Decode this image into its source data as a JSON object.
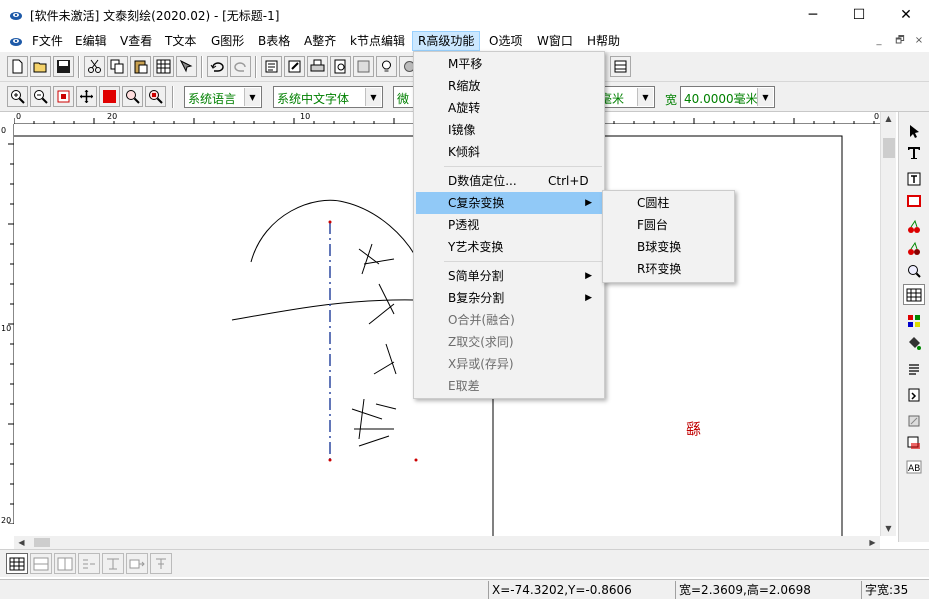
{
  "window": {
    "title": "[软件未激活] 文泰刻绘(2020.02) - [无标题-1]",
    "minimize": "─",
    "maximize": "☐",
    "close": "✕"
  },
  "menubar": {
    "items": [
      "F文件",
      "E编辑",
      "V查看",
      "T文本",
      "G图形",
      "B表格",
      "A整齐",
      "k节点编辑",
      "R高级功能",
      "O选项",
      "W窗口",
      "H帮助"
    ],
    "active_index": 8,
    "mdi": [
      "_",
      "🗗",
      "×"
    ]
  },
  "toolbar2": {
    "font_language": "系统语言",
    "font_name": "系统中文字体",
    "font_partial": "微",
    "height_value": "毫米",
    "width_label": "宽",
    "width_value": "40.0000毫米"
  },
  "ruler": {
    "h_labels": [
      "0",
      "20",
      "10",
      "0"
    ],
    "v_labels": [
      "0",
      "10",
      "20"
    ]
  },
  "dropdown": {
    "items": [
      {
        "label": "M平移",
        "enabled": true
      },
      {
        "label": "R缩放",
        "enabled": true
      },
      {
        "label": "A旋转",
        "enabled": true
      },
      {
        "label": "I镜像",
        "enabled": true
      },
      {
        "label": "K倾斜",
        "enabled": true
      },
      {
        "label": "D数值定位...",
        "shortcut": "Ctrl+D",
        "enabled": true
      },
      {
        "label": "C复杂变换",
        "enabled": true,
        "submenu": true,
        "highlighted": true
      },
      {
        "label": "P透视",
        "enabled": true
      },
      {
        "label": "Y艺术变换",
        "enabled": true
      },
      {
        "label": "S简单分割",
        "enabled": true,
        "submenu": true
      },
      {
        "label": "B复杂分割",
        "enabled": true,
        "submenu": true
      },
      {
        "label": "O合并(融合)",
        "enabled": false
      },
      {
        "label": "Z取交(求同)",
        "enabled": false
      },
      {
        "label": "X异或(存异)",
        "enabled": false
      },
      {
        "label": "E取差",
        "enabled": false
      }
    ],
    "sub_arrow": "▶"
  },
  "submenu": {
    "items": [
      "C圆柱",
      "F圆台",
      "B球变换",
      "R环变换"
    ]
  },
  "canvas": {
    "red_glyph": "繇"
  },
  "statusbar": {
    "coords": "X=-74.3202,Y=-0.8606",
    "size": "宽=2.3609,高=2.0698",
    "char_width": "字宽:35"
  },
  "colors": {
    "menu_highlight": "#91c9f7",
    "active_menu": "#cce8ff",
    "combo_text": "#008000",
    "red_glyph": "#c00000"
  }
}
